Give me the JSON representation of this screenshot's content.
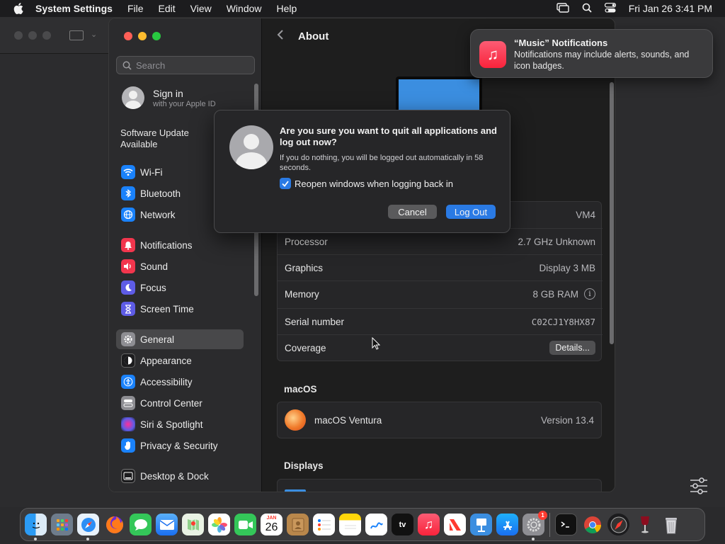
{
  "menubar": {
    "app_name": "System Settings",
    "items": [
      "File",
      "Edit",
      "View",
      "Window",
      "Help"
    ],
    "clock": "Fri Jan 26  3:41 PM"
  },
  "search": {
    "placeholder": "Search"
  },
  "signin": {
    "title": "Sign in",
    "subtitle": "with your Apple ID"
  },
  "software_update": "Software Update Available",
  "sidebar": {
    "items": [
      {
        "label": "Wi-Fi",
        "icon": "wifi-icon",
        "color": "#1a82fb"
      },
      {
        "label": "Bluetooth",
        "icon": "bluetooth-icon",
        "color": "#1a82fb"
      },
      {
        "label": "Network",
        "icon": "globe-icon",
        "color": "#1a82fb"
      },
      {
        "label": "Notifications",
        "icon": "bell-icon",
        "color": "#f2364d"
      },
      {
        "label": "Sound",
        "icon": "speaker-icon",
        "color": "#f2364d"
      },
      {
        "label": "Focus",
        "icon": "moon-icon",
        "color": "#5e5ce6"
      },
      {
        "label": "Screen Time",
        "icon": "hourglass-icon",
        "color": "#5e5ce6"
      },
      {
        "label": "General",
        "icon": "gear-icon",
        "color": "#8e8e93"
      },
      {
        "label": "Appearance",
        "icon": "appearance-icon",
        "color": "#1c1c1e"
      },
      {
        "label": "Accessibility",
        "icon": "accessibility-icon",
        "color": "#1a82fb"
      },
      {
        "label": "Control Center",
        "icon": "control-center-icon",
        "color": "#8e8e93"
      },
      {
        "label": "Siri & Spotlight",
        "icon": "siri-icon",
        "color": "#7c3aed"
      },
      {
        "label": "Privacy & Security",
        "icon": "hand-icon",
        "color": "#1a82fb"
      },
      {
        "label": "Desktop & Dock",
        "icon": "dock-icon",
        "color": "#1c1c1e"
      }
    ]
  },
  "main": {
    "title": "About",
    "info": [
      {
        "label": "",
        "value": "VM4"
      },
      {
        "label": "Processor",
        "value": "2.7 GHz Unknown"
      },
      {
        "label": "Graphics",
        "value": "Display 3 MB"
      },
      {
        "label": "Memory",
        "value": "8 GB RAM"
      },
      {
        "label": "Serial number",
        "value": "C02CJ1Y8HX87"
      },
      {
        "label": "Coverage",
        "value": "Details..."
      }
    ],
    "macos_section": "macOS",
    "os_name": "macOS Ventura",
    "os_version": "Version 13.4",
    "displays_section": "Displays"
  },
  "dialog": {
    "title": "Are you sure you want to quit all applications and log out now?",
    "message": "If you do nothing, you will be logged out automatically in 58 seconds.",
    "checkbox_label": "Reopen windows when logging back in",
    "checkbox_checked": true,
    "cancel_label": "Cancel",
    "confirm_label": "Log Out"
  },
  "notification": {
    "title": "“Music” Notifications",
    "body": "Notifications may include alerts, sounds, and icon badges."
  },
  "dock": {
    "calendar_month": "JAN",
    "calendar_day": "26",
    "tv_label": "tv",
    "settings_badge": "1"
  }
}
